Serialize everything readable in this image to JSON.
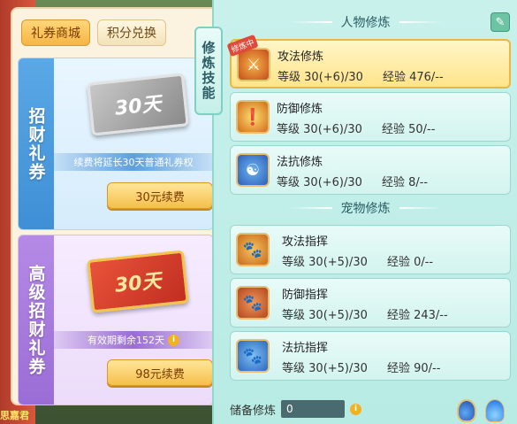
{
  "tabs": [
    {
      "label": "礼券商城",
      "active": true
    },
    {
      "label": "积分兑换",
      "active": false
    }
  ],
  "cards": {
    "basic": {
      "side_label": "招财礼券",
      "ticket_text": "30天",
      "note": "续费将延长30天普通礼券权",
      "button": "30元续费"
    },
    "premium": {
      "side_label": "高级招财礼券",
      "ticket_text": "30天",
      "note": "有效期剩余152天",
      "button": "98元续费"
    }
  },
  "side_tab": "修炼技能",
  "bg_name": "思嘉君",
  "sections": {
    "character": "人物修炼",
    "pet": "宠物修炼"
  },
  "character_skills": [
    {
      "name": "攻法修炼",
      "level_label": "等级",
      "level": "30(+6)/30",
      "exp_label": "经验",
      "exp": "476/--",
      "active": true,
      "badge": "修炼中",
      "icon": "attack-skill-icon"
    },
    {
      "name": "防御修炼",
      "level_label": "等级",
      "level": "30(+6)/30",
      "exp_label": "经验",
      "exp": "50/--",
      "icon": "defense-skill-icon"
    },
    {
      "name": "法抗修炼",
      "level_label": "等级",
      "level": "30(+6)/30",
      "exp_label": "经验",
      "exp": "8/--",
      "icon": "resist-skill-icon"
    }
  ],
  "pet_skills": [
    {
      "name": "攻法指挥",
      "level_label": "等级",
      "level": "30(+5)/30",
      "exp_label": "经验",
      "exp": "0/--",
      "icon": "pet-attack-icon"
    },
    {
      "name": "防御指挥",
      "level_label": "等级",
      "level": "30(+5)/30",
      "exp_label": "经验",
      "exp": "243/--",
      "icon": "pet-defense-icon"
    },
    {
      "name": "法抗指挥",
      "level_label": "等级",
      "level": "30(+5)/30",
      "exp_label": "经验",
      "exp": "90/--",
      "icon": "pet-resist-icon"
    }
  ],
  "reserve": {
    "label": "储备修炼",
    "value": "0"
  },
  "info_glyph": "i"
}
